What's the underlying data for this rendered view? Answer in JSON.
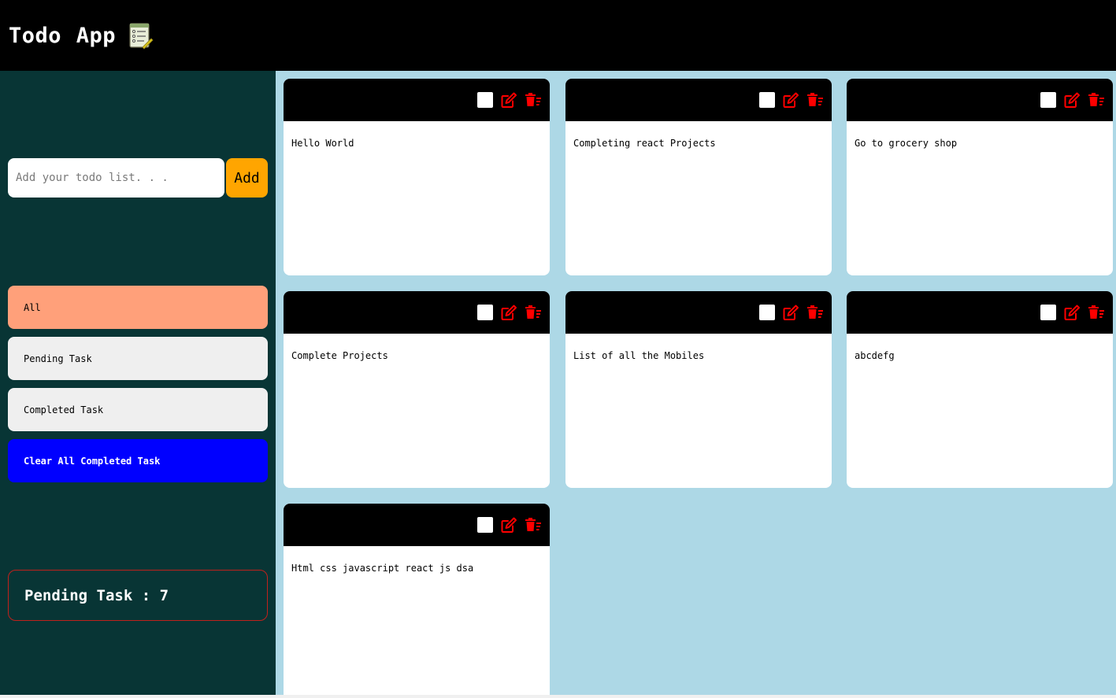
{
  "header": {
    "title": "Todo App",
    "logo_icon": "notepad-checklist-icon"
  },
  "colors": {
    "header_bg": "#000000",
    "sidebar_bg": "#083535",
    "main_bg": "#add8e6",
    "add_button": "#ffa500",
    "active_filter": "#ffa07a",
    "clear_button": "#0000ff",
    "action_icon": "#ff0000"
  },
  "sidebar": {
    "input_placeholder": "Add your todo list. . .",
    "input_value": "",
    "add_label": "Add",
    "filters": [
      {
        "label": "All",
        "active": true
      },
      {
        "label": "Pending Task",
        "active": false
      },
      {
        "label": "Completed Task",
        "active": false
      }
    ],
    "clear_label": "Clear All Completed Task",
    "pending": {
      "label": "Pending Task : ",
      "count": "7"
    }
  },
  "todos": [
    {
      "text": "Hello World",
      "checked": false
    },
    {
      "text": "Completing react Projects",
      "checked": false
    },
    {
      "text": "Go to grocery shop",
      "checked": false
    },
    {
      "text": "Complete Projects",
      "checked": false
    },
    {
      "text": "List of all the Mobiles",
      "checked": false
    },
    {
      "text": "abcdefg",
      "checked": false
    },
    {
      "text": "Html css javascript react js dsa",
      "checked": false
    }
  ]
}
